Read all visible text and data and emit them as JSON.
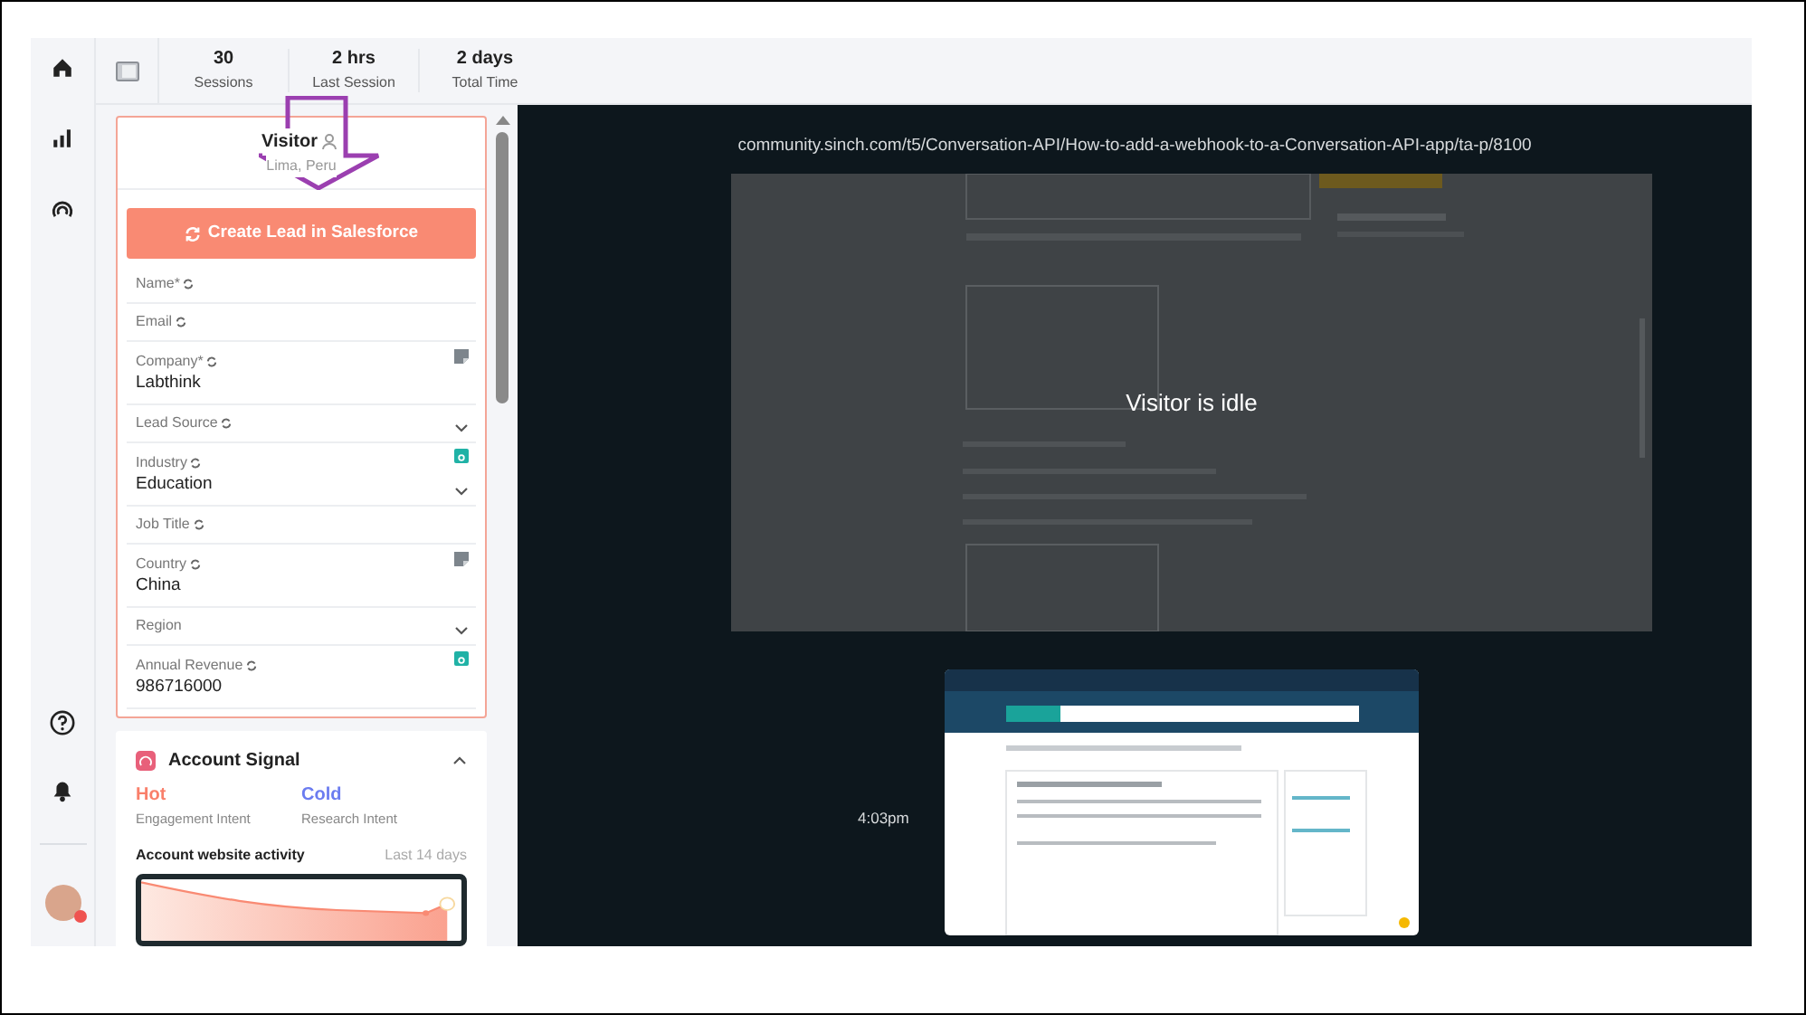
{
  "nav": {
    "top_items": [
      {
        "kind": "home",
        "selected": false
      },
      {
        "kind": "chart",
        "selected": false
      },
      {
        "kind": "signal",
        "selected": false
      }
    ],
    "bottom_items": [
      {
        "kind": "help"
      },
      {
        "kind": "bell"
      }
    ],
    "avatar": {
      "online": false
    }
  },
  "stats": [
    {
      "value": "30",
      "label": "Sessions"
    },
    {
      "value": "2 hrs",
      "label": "Last Session"
    },
    {
      "value": "2 days",
      "label": "Total Time"
    }
  ],
  "visitor": {
    "name": "Visitor",
    "location": "Lima, Peru"
  },
  "create_button": "Create Lead in Salesforce",
  "fields": [
    {
      "label": "Name*",
      "kind": "text",
      "sync": true
    },
    {
      "label": "Email",
      "kind": "text",
      "sync": true
    },
    {
      "label": "Company*",
      "kind": "text",
      "sync": true,
      "value": "Labthink",
      "marker": {
        "kind": "square"
      }
    },
    {
      "label": "Lead Source",
      "kind": "select",
      "sync": true
    },
    {
      "label": "Industry",
      "kind": "select",
      "sync": true,
      "value": "Education",
      "marker": {
        "kind": "badge"
      }
    },
    {
      "label": "Job Title",
      "kind": "text",
      "sync": true
    },
    {
      "label": "Country",
      "kind": "text",
      "sync": true,
      "value": "China",
      "marker": {
        "kind": "square"
      }
    },
    {
      "label": "Region",
      "kind": "select",
      "sync": false
    },
    {
      "label": "Annual Revenue",
      "kind": "text",
      "sync": true,
      "value": "986716000",
      "marker": {
        "kind": "badge"
      }
    }
  ],
  "account_signal": {
    "title": "Account Signal",
    "expanded": true,
    "intents": [
      {
        "value": "Hot",
        "label": "Engagement Intent",
        "color": "#f97f6a"
      },
      {
        "value": "Cold",
        "label": "Research Intent",
        "color": "#6b7cf0"
      }
    ],
    "activity": {
      "title": "Account website activity",
      "range": "Last 14 days"
    }
  },
  "player": {
    "url": "community.sinch.com/t5/Conversation-API/How-to-add-a-webhook-to-a-Conversation-API-app/ta-p/8100",
    "idle_message": "Visitor is idle",
    "timestamp": "4:03pm"
  }
}
